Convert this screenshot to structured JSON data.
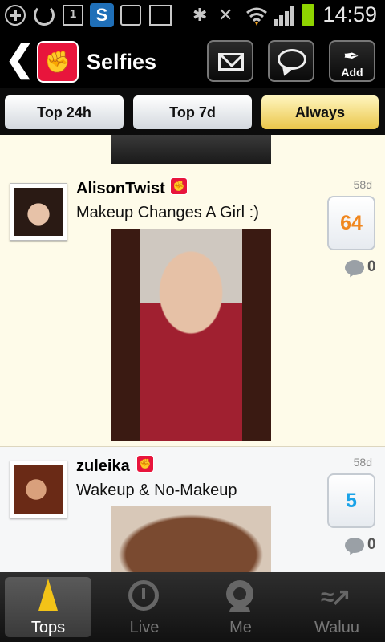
{
  "status_bar": {
    "time": "14:59",
    "calendar_day": "1",
    "app_badge": "S",
    "icons": [
      "add-circle-icon",
      "sync-icon",
      "calendar-icon",
      "skype-icon",
      "sd-card-icon",
      "image-icon",
      "bluetooth-icon",
      "mute-icon",
      "wifi-icon",
      "signal-icon",
      "battery-icon"
    ]
  },
  "header": {
    "title": "Selfies",
    "add_label": "Add"
  },
  "tabs": [
    {
      "label": "Top 24h",
      "active": false
    },
    {
      "label": "Top 7d",
      "active": false
    },
    {
      "label": "Always",
      "active": true
    }
  ],
  "posts": [
    {
      "username": "AlisonTwist",
      "caption": "Makeup Changes A Girl :)",
      "age": "58d",
      "score": "64",
      "comments": "0"
    },
    {
      "username": "zuleika",
      "caption": "Wakeup & No-Makeup",
      "age": "58d",
      "score": "5",
      "comments": "0"
    }
  ],
  "bottom_nav": [
    {
      "label": "Tops",
      "active": true
    },
    {
      "label": "Live",
      "active": false
    },
    {
      "label": "Me",
      "active": false
    },
    {
      "label": "Waluu",
      "active": false
    }
  ],
  "colors": {
    "accent_red": "#e8153c",
    "active_tab": "#eac64a",
    "score_orange": "#f0871f",
    "score_blue": "#1aa3e8",
    "tops_icon": "#f2c318"
  }
}
